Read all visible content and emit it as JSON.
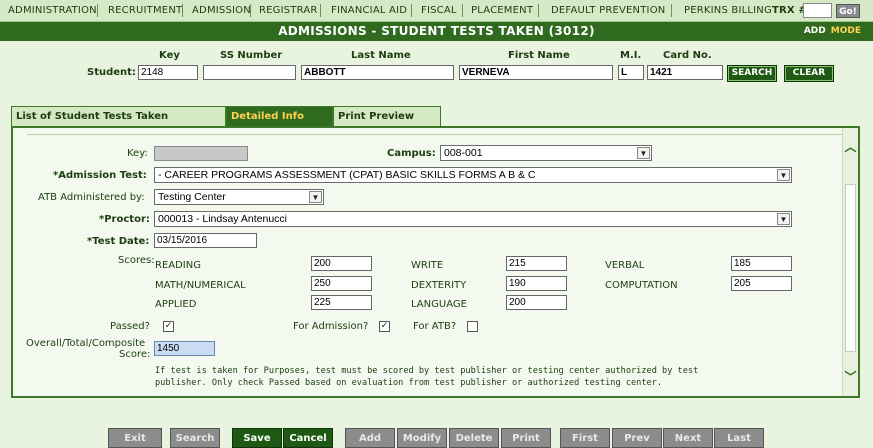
{
  "nav": {
    "items": [
      "ADMINISTRATION",
      "RECRUITMENT",
      "ADMISSION",
      "REGISTRAR",
      "FINANCIAL AID",
      "FISCAL",
      "PLACEMENT",
      "DEFAULT PREVENTION",
      "PERKINS BILLING"
    ],
    "trx_label": "TRX #:",
    "trx_value": "",
    "go_label": "Go!"
  },
  "title": {
    "text": "ADMISSIONS - STUDENT TESTS TAKEN (3012)",
    "mode_value": "ADD",
    "mode_label": "MODE"
  },
  "student": {
    "row_label": "Student:",
    "headers": {
      "key": "Key",
      "ssn": "SS Number",
      "last": "Last Name",
      "first": "First Name",
      "mi": "M.I.",
      "card": "Card No."
    },
    "key": "2148",
    "ssn": "",
    "last": "ABBOTT",
    "first": "VERNEVA",
    "mi": "L",
    "card": "1421",
    "search_label": "SEARCH",
    "clear_label": "CLEAR"
  },
  "tabs": [
    {
      "label": "List of Student Tests Taken",
      "active": false
    },
    {
      "label": "Detailed Info",
      "active": true
    },
    {
      "label": "Print Preview",
      "active": false
    }
  ],
  "form": {
    "key_label": "Key:",
    "key_value": "",
    "campus_label": "Campus:",
    "campus_value": "008-001",
    "test_label": "*Admission Test:",
    "test_value": "- CAREER PROGRAMS ASSESSMENT (CPAT) BASIC SKILLS FORMS A  B & C",
    "atb_label": "ATB Administered by:",
    "atb_value": "Testing Center",
    "proctor_label": "*Proctor:",
    "proctor_value": "000013 - Lindsay Antenucci",
    "date_label": "*Test Date:",
    "date_value": "03/15/2016",
    "scores_label": "Scores:",
    "scores": [
      {
        "label": "READING",
        "value": "200"
      },
      {
        "label": "WRITE",
        "value": "215"
      },
      {
        "label": "VERBAL",
        "value": "185"
      },
      {
        "label": "MATH/NUMERICAL",
        "value": "250"
      },
      {
        "label": "DEXTERITY",
        "value": "190"
      },
      {
        "label": "COMPUTATION",
        "value": "205"
      },
      {
        "label": "APPLIED",
        "value": "225"
      },
      {
        "label": "LANGUAGE",
        "value": "200"
      }
    ],
    "passed_label": "Passed?",
    "passed_checked": true,
    "for_admission_label": "For Admission?",
    "for_admission_checked": true,
    "for_atb_label": "For ATB?",
    "for_atb_checked": false,
    "overall_label_1": "Overall/Total/Composite",
    "overall_label_2": "Score:",
    "overall_value": "1450",
    "note_line1": "If test is taken for Purposes, test must be scored by test publisher or testing center authorized by test",
    "note_line2": "publisher. Only check Passed based on evaluation from test publisher or authorized testing center."
  },
  "buttons": [
    "Exit",
    "Search",
    "Save",
    "Cancel",
    "Add",
    "Modify",
    "Delete",
    "Print",
    "First",
    "Prev",
    "Next",
    "Last"
  ],
  "colors": {
    "accent": "#2f6a1f",
    "tab_active_text": "#ffd34d",
    "background": "#e8f3e0"
  }
}
